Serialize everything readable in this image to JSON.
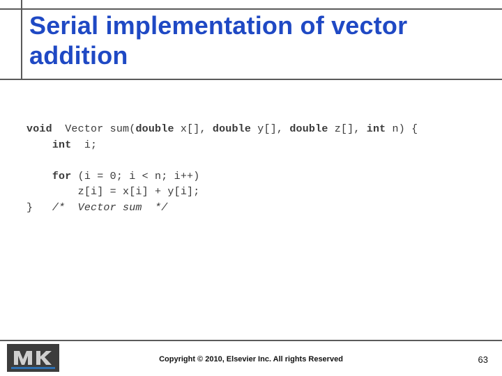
{
  "title": "Serial implementation of vector addition",
  "code": {
    "l1_kw_void": "void",
    "l1_mid": "  Vector sum(",
    "l1_kw_d1": "double",
    "l1_a1": " x[], ",
    "l1_kw_d2": "double",
    "l1_a2": " y[], ",
    "l1_kw_d3": "double",
    "l1_a3": " z[], ",
    "l1_kw_int": "int",
    "l1_end": " n) {",
    "l2_kw_int": "int",
    "l2_rest": "  i;",
    "l4_kw_for": "for",
    "l4_rest": " (i = 0; i < n; i++)",
    "l5": "        z[i] = x[i] + y[i];",
    "l6_brace": "}   ",
    "l6_cm": "/*  Vector sum  */"
  },
  "footer": {
    "copyright": "Copyright © 2010, Elsevier Inc. All rights Reserved",
    "page": "63",
    "logo_label": "MK"
  }
}
